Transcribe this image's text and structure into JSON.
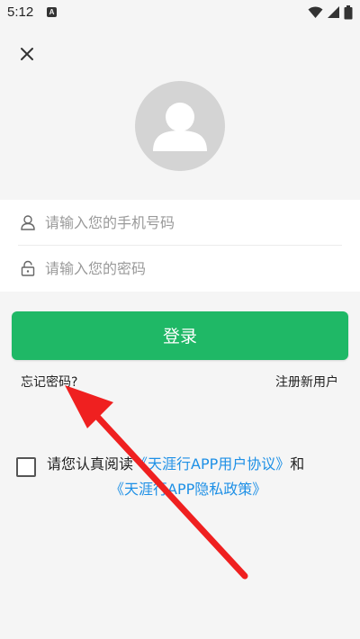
{
  "status_bar": {
    "time": "5:12",
    "notification_glyph": "A",
    "icons": [
      "wifi-icon",
      "signal-icon",
      "battery-icon"
    ]
  },
  "header": {
    "close_icon": "close-icon"
  },
  "avatar": {
    "icon": "user-silhouette-icon"
  },
  "login_form": {
    "phone_placeholder": "请输入您的手机号码",
    "phone_value": "",
    "password_placeholder": "请输入您的密码",
    "password_value": "",
    "login_label": "登录",
    "forgot_password_label": "忘记密码?",
    "register_label": "注册新用户"
  },
  "agreement": {
    "prefix": "请您认真阅读",
    "user_agreement_link": "《天涯行APP用户协议》",
    "conjunction": "和",
    "privacy_policy_link": "《天涯行APP隐私政策》",
    "checked": false
  },
  "colors": {
    "accent_green": "#1fb866",
    "link_blue": "#1e90e6",
    "annotation_red": "#ef2020"
  }
}
